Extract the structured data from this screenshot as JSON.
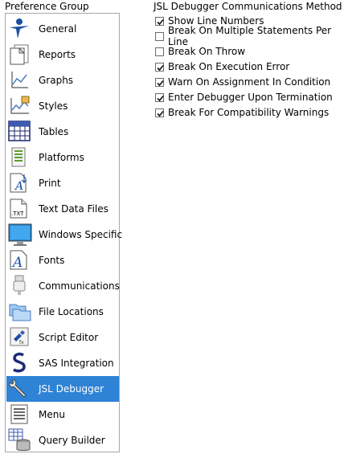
{
  "preference_group": {
    "title": "Preference Group",
    "selected": "JSL Debugger",
    "items": [
      {
        "label": "General",
        "icon": "general-icon"
      },
      {
        "label": "Reports",
        "icon": "reports-icon"
      },
      {
        "label": "Graphs",
        "icon": "graphs-icon"
      },
      {
        "label": "Styles",
        "icon": "styles-icon"
      },
      {
        "label": "Tables",
        "icon": "tables-icon"
      },
      {
        "label": "Platforms",
        "icon": "platforms-icon"
      },
      {
        "label": "Print",
        "icon": "print-icon"
      },
      {
        "label": "Text Data Files",
        "icon": "text-data-files-icon"
      },
      {
        "label": "Windows Specific",
        "icon": "windows-specific-icon"
      },
      {
        "label": "Fonts",
        "icon": "fonts-icon"
      },
      {
        "label": "Communications",
        "icon": "communications-icon"
      },
      {
        "label": "File Locations",
        "icon": "file-locations-icon"
      },
      {
        "label": "Script Editor",
        "icon": "script-editor-icon"
      },
      {
        "label": "SAS Integration",
        "icon": "sas-integration-icon"
      },
      {
        "label": "JSL Debugger",
        "icon": "jsl-debugger-icon"
      },
      {
        "label": "Menu",
        "icon": "menu-icon"
      },
      {
        "label": "Query Builder",
        "icon": "query-builder-icon"
      }
    ]
  },
  "jsl_debugger": {
    "title": "JSL Debugger Communications Method",
    "options": [
      {
        "label": "Show Line Numbers",
        "checked": true
      },
      {
        "label": "Break On Multiple Statements Per Line",
        "checked": false
      },
      {
        "label": "Break On Throw",
        "checked": false
      },
      {
        "label": "Break On Execution Error",
        "checked": true
      },
      {
        "label": "Warn On Assignment In Condition",
        "checked": true
      },
      {
        "label": "Enter Debugger Upon Termination",
        "checked": true
      },
      {
        "label": "Break For Compatibility Warnings",
        "checked": true
      }
    ]
  },
  "colors": {
    "selection": "#2f83d6",
    "border": "#a8a8a8"
  }
}
